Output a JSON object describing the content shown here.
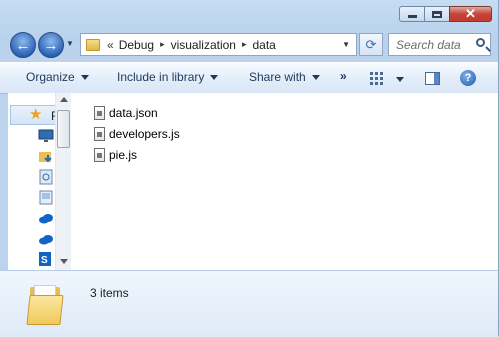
{
  "window": {
    "buttons": {
      "minimize": "minimize",
      "maximize": "maximize",
      "close": "close"
    }
  },
  "address": {
    "prefix": "«",
    "crumbs": [
      "Debug",
      "visualization",
      "data"
    ],
    "separator": "▸"
  },
  "search": {
    "placeholder": "Search data"
  },
  "toolbar": {
    "organize": "Organize",
    "include": "Include in library",
    "share": "Share with",
    "more": "»"
  },
  "nav": {
    "favorites_label": "F",
    "icons": [
      "desktop-icon",
      "downloads-icon",
      "recent-places-icon",
      "computer-icon",
      "onedrive-icon",
      "onedrive-icon",
      "sharepoint-icon"
    ]
  },
  "files": [
    {
      "name": "data.json",
      "icon": "json-file-icon"
    },
    {
      "name": "developers.js",
      "icon": "js-file-icon"
    },
    {
      "name": "pie.js",
      "icon": "js-file-icon"
    }
  ],
  "details": {
    "count": "3 items"
  },
  "colors": {
    "accent": "#3b6fb4",
    "star": "#e9a321",
    "folder": "#f0c95a"
  }
}
